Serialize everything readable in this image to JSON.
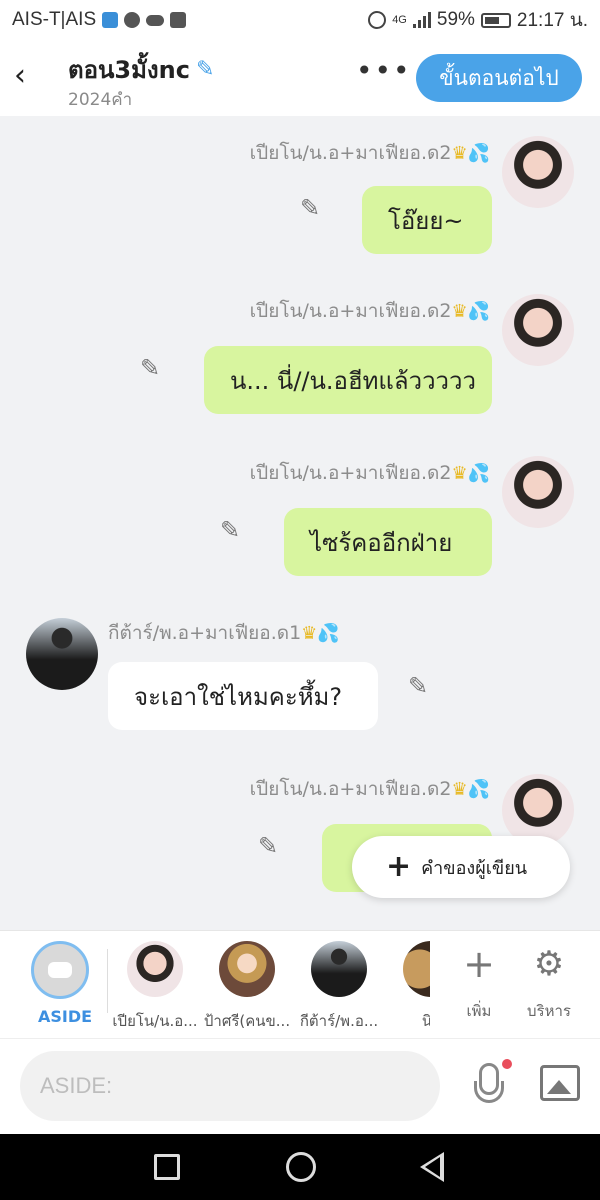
{
  "status": {
    "carrier": "AIS-T|AIS",
    "battery": "59%",
    "time": "21:17 น.",
    "network": "4G"
  },
  "header": {
    "title": "ตอน3มั้งnc",
    "word_count": "2024คำ",
    "more": "•••",
    "next_button": "ขั้นตอนต่อไป"
  },
  "messages": [
    {
      "sender": "เปียโน/น.อ+มาเฟียอ.ด2",
      "text": "โอ๊ยย~",
      "side": "right"
    },
    {
      "sender": "เปียโน/น.อ+มาเฟียอ.ด2",
      "text": "น... นี่//น.อฮีทแล้ววววว",
      "side": "right"
    },
    {
      "sender": "เปียโน/น.อ+มาเฟียอ.ด2",
      "text": "ไซร้คออีกฝ่าย",
      "side": "right"
    },
    {
      "sender": "กีต้าร์/พ.อ+มาเฟียอ.ด1",
      "text": "จะเอาใช่ไหมคะหึ้ม?",
      "side": "left"
    },
    {
      "sender": "เปียโน/น.อ+มาเฟียอ.ด2",
      "text": "",
      "side": "right"
    }
  ],
  "author_note_button": "คำของผู้เขียน",
  "charbar": {
    "aside_label": "ASIDE",
    "characters": [
      "เปียโน/น.อ...",
      "ป้าศรี(คนข...",
      "กีต้าร์/พ.อ...",
      "นิร"
    ],
    "add_label": "เพิ่ม",
    "manage_label": "บริหาร"
  },
  "input": {
    "placeholder": "ASIDE:"
  },
  "icons": {
    "back": "back-arrow-icon",
    "edit": "pencil-icon",
    "mic": "microphone-icon",
    "image": "image-icon"
  },
  "colors": {
    "accent": "#4aa3e8",
    "bubble_right": "#d8f59f",
    "bubble_left": "#ffffff",
    "background": "#f1f2f4"
  }
}
